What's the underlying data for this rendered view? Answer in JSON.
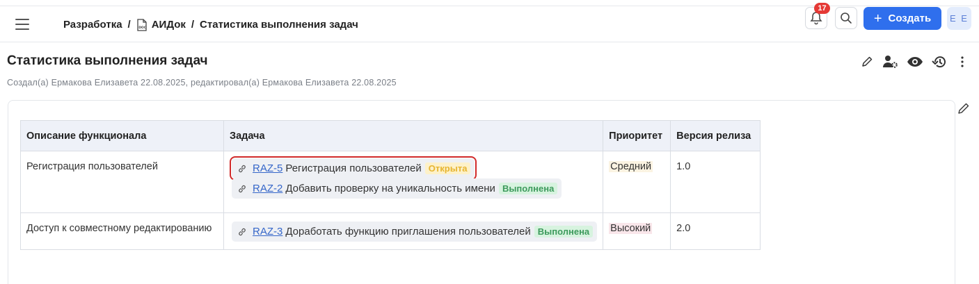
{
  "header": {
    "breadcrumb": {
      "items": [
        "Разработка",
        "АИДок",
        "Статистика выполнения задач"
      ],
      "separator": "/"
    },
    "notifications_count": "17",
    "create_label": "Создать",
    "avatar_initials": "Е Е"
  },
  "page": {
    "title": "Статистика выполнения задач",
    "meta": "Создал(а) Ермакова Елизавета 22.08.2025, редактировал(а) Ермакова Елизавета 22.08.2025"
  },
  "table": {
    "columns": [
      "Описание функционала",
      "Задача",
      "Приоритет",
      "Версия релиза"
    ],
    "rows": [
      {
        "description": "Регистрация пользователей",
        "tasks": [
          {
            "key": "RAZ-5",
            "title": "Регистрация пользователей",
            "status": "Открыта"
          },
          {
            "key": "RAZ-2",
            "title": "Добавить проверку на уникальность имени",
            "status": "Выполнена"
          }
        ],
        "priority": "Средний",
        "version": "1.0"
      },
      {
        "description": "Доступ к совместному редактированию",
        "tasks": [
          {
            "key": "RAZ-3",
            "title": "Доработать функцию приглашения пользователей",
            "status": "Выполнена"
          }
        ],
        "priority": "Высокий",
        "version": "2.0"
      }
    ]
  },
  "colors": {
    "accent": "#2f6fed",
    "badge": "#e53935",
    "status_open": "#e7b531",
    "status_done": "#3d9a5c",
    "highlight": "#d12a2a"
  }
}
